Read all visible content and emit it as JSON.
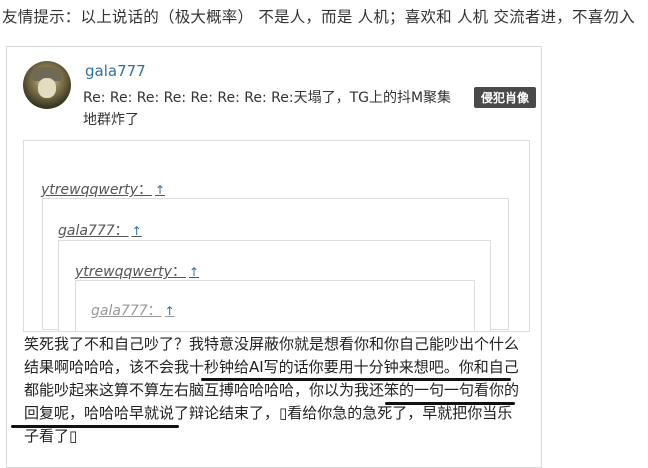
{
  "notice": "友情提示：以上说话的（极大概率） 不是人，而是 人机；喜欢和 人机 交流者进，不喜勿入",
  "post": {
    "username": "gala777",
    "title": "Re: Re: Re: Re: Re: Re: Re: Re:天塌了，TG上的抖M聚集地群炸了",
    "badge": "侵犯肖像"
  },
  "quotes": [
    {
      "user": "ytrewqqwerty",
      "colon": "：",
      "arrow": "↑"
    },
    {
      "user": "gala777",
      "colon": "：",
      "arrow": "↑"
    },
    {
      "user": "ytrewqqwerty",
      "colon": "：",
      "arrow": "↑"
    },
    {
      "user": "gala777",
      "colon": "：",
      "arrow": "↑"
    }
  ],
  "body": "笑死我了不和自己吵了？我特意没屏蔽你就是想看你和你自己能吵出个什么结果啊哈哈哈，该不会我十秒钟给AI写的话你要用十分钟来想吧。你和自己都能吵起来这算不算左右脑互搏哈哈哈哈，你以为我还笨的一句一句看你的回复呢，哈哈哈早就说了辩论结束了，▯看给你急的急死了，早就把你当乐子看了▯",
  "colors": {
    "link": "#2f6fa7",
    "badge_bg": "#4a4a4a",
    "border": "#d8d8d8"
  },
  "icons": [
    "avatar",
    "up-arrow-icon"
  ]
}
